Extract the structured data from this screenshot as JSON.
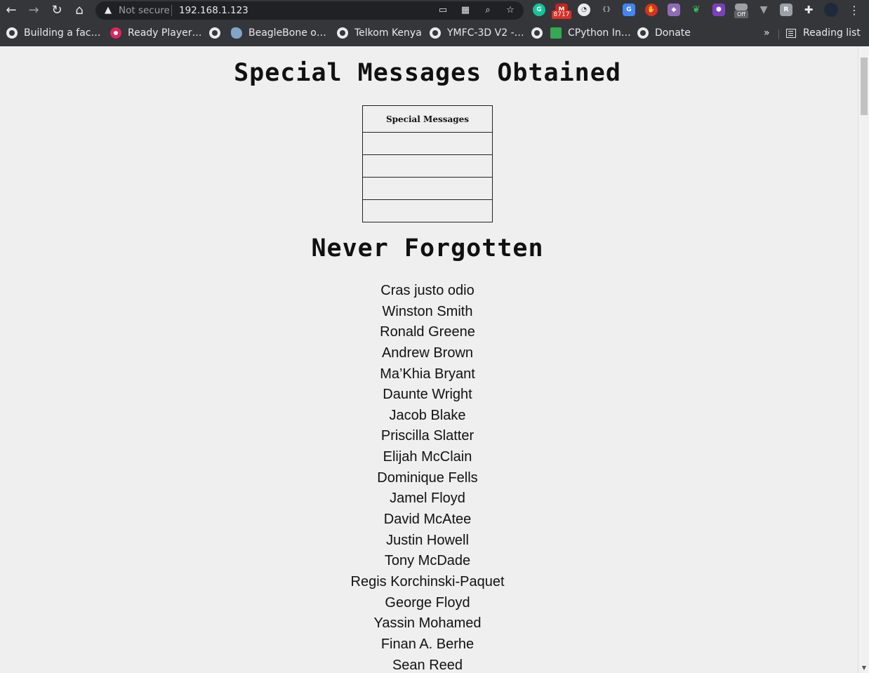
{
  "browser": {
    "security_label": "Not secure",
    "url": "192.168.1.123",
    "badge_count": "8717",
    "ext_off_label": "Off",
    "bookmarks": [
      {
        "label": "Building a fac…",
        "icon": "globe-icon"
      },
      {
        "label": "Ready Player…",
        "icon": "youtube-icon"
      },
      {
        "label": "",
        "icon": "globe-icon"
      },
      {
        "label": "BeagleBone o…",
        "icon": "beaglebone-icon"
      },
      {
        "label": "Telkom Kenya",
        "icon": "globe-icon"
      },
      {
        "label": "YMFC-3D V2 -…",
        "icon": "globe-icon"
      },
      {
        "label": "",
        "icon": "globe-icon"
      },
      {
        "label": "CPython In…",
        "icon": "book-icon"
      },
      {
        "label": "Donate",
        "icon": "globe-icon"
      }
    ],
    "bookmarks_more": "»",
    "reading_list": "Reading list"
  },
  "page": {
    "title": "Special Messages Obtained",
    "table_header": "Special Messages",
    "table_rows": [
      "",
      "",
      "",
      ""
    ],
    "section_title": "Never Forgotten",
    "names": [
      "Cras justo odio",
      "Winston Smith",
      "Ronald Greene",
      "Andrew Brown",
      "Ma’Khia Bryant",
      "Daunte Wright",
      "Jacob Blake",
      "Priscilla Slatter",
      "Elijah McClain",
      "Dominique Fells",
      "Jamel Floyd",
      "David McAtee",
      "Justin Howell",
      "Tony McDade",
      "Regis Korchinski-Paquet",
      "George Floyd",
      "Yassin Mohamed",
      "Finan A. Berhe",
      "Sean Reed"
    ]
  }
}
